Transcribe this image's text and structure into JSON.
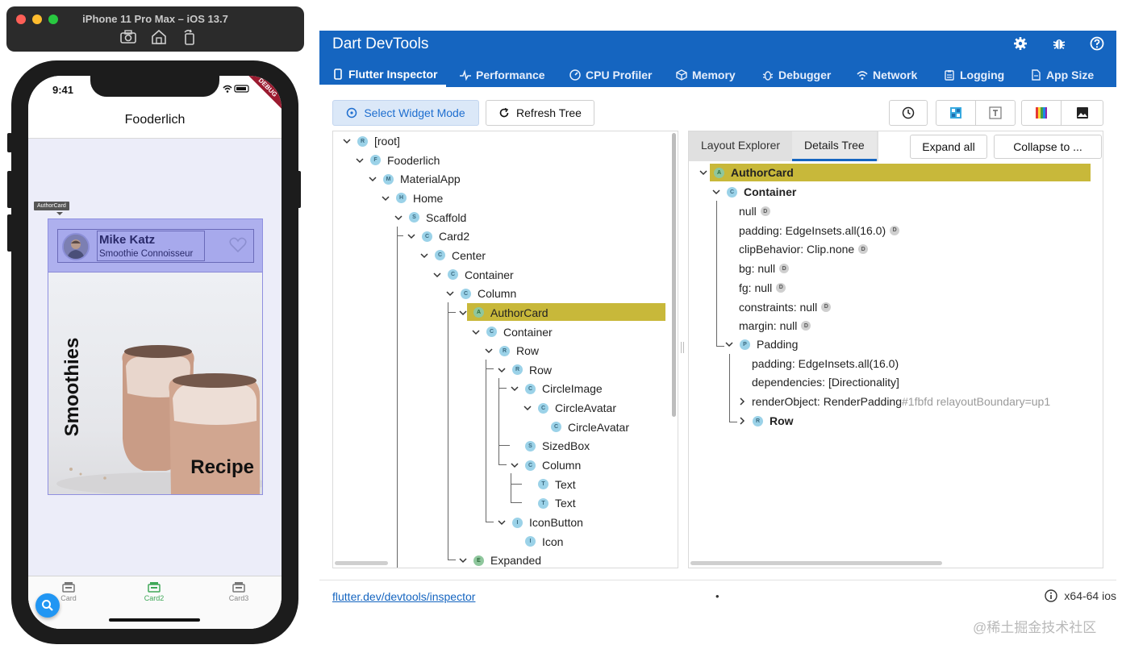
{
  "simulator": {
    "title": "iPhone 11 Pro Max – iOS 13.7",
    "traffic_colors": [
      "#fe5f57",
      "#febc2e",
      "#28c840"
    ]
  },
  "phone": {
    "time": "9:41",
    "debug_banner": "DEBUG",
    "app_title": "Fooderlich",
    "tooltip": "AuthorCard",
    "card": {
      "author_name": "Mike Katz",
      "author_title": "Smoothie Connoisseur",
      "vertical_title": "Smoothies",
      "subtitle": "Recipe"
    },
    "nav": [
      {
        "label": "Card",
        "active": false
      },
      {
        "label": "Card2",
        "active": true
      },
      {
        "label": "Card3",
        "active": false
      }
    ],
    "accent_green": "#3fa858",
    "fab_color": "#2196f3"
  },
  "devtools": {
    "title": "Dart DevTools",
    "header_color": "#1565c0",
    "header_icons": [
      "settings-icon",
      "bug-icon",
      "help-icon"
    ],
    "tabs": [
      {
        "label": "Flutter Inspector",
        "icon": "phone-icon",
        "active": true
      },
      {
        "label": "Performance",
        "icon": "pulse-icon",
        "active": false
      },
      {
        "label": "CPU Profiler",
        "icon": "gauge-icon",
        "active": false
      },
      {
        "label": "Memory",
        "icon": "box-icon",
        "active": false
      },
      {
        "label": "Debugger",
        "icon": "bug-icon",
        "active": false
      },
      {
        "label": "Network",
        "icon": "wifi-icon",
        "active": false
      },
      {
        "label": "Logging",
        "icon": "clipboard-icon",
        "active": false
      },
      {
        "label": "App Size",
        "icon": "file-icon",
        "active": false
      }
    ],
    "toolbar": {
      "select_widget_mode": "Select Widget Mode",
      "refresh_tree": "Refresh Tree",
      "icon_buttons": [
        "history-icon",
        "layout-grid-icon",
        "text-baseline-icon",
        "color-bars-icon",
        "image-icon"
      ]
    },
    "tree": [
      {
        "label": "[root]",
        "badge": "R",
        "depth": 0,
        "expanded": true
      },
      {
        "label": "Fooderlich",
        "badge": "F",
        "depth": 1,
        "expanded": true
      },
      {
        "label": "MaterialApp",
        "badge": "M",
        "depth": 2,
        "expanded": true
      },
      {
        "label": "Home",
        "badge": "H",
        "depth": 3,
        "expanded": true
      },
      {
        "label": "Scaffold",
        "badge": "S",
        "depth": 4,
        "expanded": true
      },
      {
        "label": "Card2",
        "badge": "C",
        "depth": 5,
        "expanded": true
      },
      {
        "label": "Center",
        "badge": "C",
        "depth": 6,
        "expanded": true
      },
      {
        "label": "Container",
        "badge": "C",
        "depth": 7,
        "expanded": true
      },
      {
        "label": "Column",
        "badge": "C",
        "depth": 8,
        "expanded": true
      },
      {
        "label": "AuthorCard",
        "badge": "A",
        "depth": 9,
        "expanded": true,
        "selected": true
      },
      {
        "label": "Container",
        "badge": "C",
        "depth": 10,
        "expanded": true
      },
      {
        "label": "Row",
        "badge": "R",
        "depth": 11,
        "expanded": true
      },
      {
        "label": "Row",
        "badge": "R",
        "depth": 12,
        "expanded": true
      },
      {
        "label": "CircleImage",
        "badge": "C",
        "depth": 13,
        "expanded": true
      },
      {
        "label": "CircleAvatar",
        "badge": "C",
        "depth": 14,
        "expanded": true
      },
      {
        "label": "CircleAvatar",
        "badge": "C",
        "depth": 15,
        "expanded": false
      },
      {
        "label": "SizedBox",
        "badge": "S",
        "depth": 13,
        "expanded": false
      },
      {
        "label": "Column",
        "badge": "C",
        "depth": 13,
        "expanded": true
      },
      {
        "label": "Text",
        "badge": "T",
        "depth": 14,
        "expanded": false
      },
      {
        "label": "Text",
        "badge": "T",
        "depth": 14,
        "expanded": false
      },
      {
        "label": "IconButton",
        "badge": "I",
        "depth": 12,
        "expanded": true
      },
      {
        "label": "Icon",
        "badge": "I",
        "depth": 13,
        "expanded": false
      },
      {
        "label": "Expanded",
        "badge": "E",
        "depth": 9,
        "expanded": true
      }
    ],
    "details_tabs": [
      {
        "label": "Layout Explorer",
        "active": false
      },
      {
        "label": "Details Tree",
        "active": true
      }
    ],
    "expand_all": "Expand all",
    "collapse_to": "Collapse to ...",
    "details": {
      "selected": "AuthorCard",
      "container": "Container",
      "props": [
        {
          "text": "null",
          "badge": "D"
        },
        {
          "text": "padding: EdgeInsets.all(16.0)",
          "badge": "D"
        },
        {
          "text": "clipBehavior: Clip.none",
          "badge": "D"
        },
        {
          "text": "bg: null",
          "badge": "D"
        },
        {
          "text": "fg: null",
          "badge": "D"
        },
        {
          "text": "constraints: null",
          "badge": "D"
        },
        {
          "text": "margin: null",
          "badge": "D"
        }
      ],
      "padding_node": "Padding",
      "padding_props": [
        "padding: EdgeInsets.all(16.0)",
        "dependencies: [Directionality]"
      ],
      "render_object_label": "renderObject: RenderPadding",
      "render_object_id": "#1fbfd relayoutBoundary=up1",
      "row_node": "Row"
    },
    "footer": {
      "link": "flutter.dev/devtools/inspector",
      "dot": "•",
      "platform": "x64-64 ios"
    },
    "selection_color": "#c8b83a"
  },
  "watermark": "@稀土掘金技术社区"
}
